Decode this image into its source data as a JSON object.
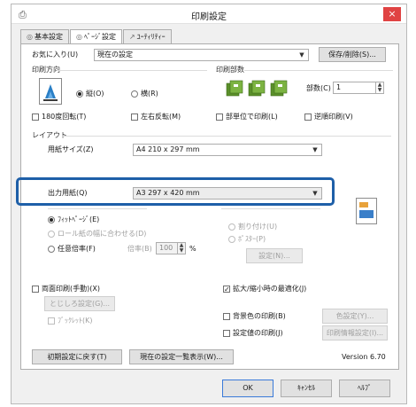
{
  "window": {
    "title": "印刷設定",
    "app_icon": "printer-icon",
    "close_label": "×"
  },
  "tabs": [
    {
      "icon": "◎",
      "label": "基本設定"
    },
    {
      "icon": "◎",
      "label": "ﾍﾟｰｼﾞ設定"
    },
    {
      "icon": "↗",
      "label": "ﾕｰﾃｨﾘﾃｨｰ"
    }
  ],
  "favorites": {
    "label": "お気に入り(U)",
    "value": "現在の設定",
    "save_button": "保存/削除(S)..."
  },
  "orientation": {
    "title": "印刷方向",
    "portrait": "縦(O)",
    "landscape": "横(R)",
    "rotate180": "180度回転(T)",
    "mirror": "左右反転(M)"
  },
  "copies": {
    "title": "印刷部数",
    "count_label": "部数(C)",
    "count_value": "1",
    "collate": "部単位で印刷(L)",
    "reverse": "逆順印刷(V)"
  },
  "layout": {
    "title": "レイアウト",
    "paper_size_label": "用紙サイズ(Z)",
    "paper_size_value": "A4 210 x 297 mm",
    "output_paper_label": "出力用紙(Q)",
    "output_paper_value": "A3 297 x 420 mm",
    "scale_fit_page": "ﾌｨｯﾄﾍﾟｰｼﾞ(E)",
    "scale_roll": "ロール紙の幅に合わせる(D)",
    "scale_custom": "任意倍率(F)",
    "scale_percent_label": "倍率(B)",
    "scale_percent_value": "100",
    "scale_percent_unit": "%",
    "multi_page": "割り付け(U)",
    "poster": "ﾎﾟｽﾀｰ(P)",
    "settings_button": "設定(N)..."
  },
  "duplex": {
    "manual": "両面印刷(手動)(X)",
    "binding_button": "とじしろ設定(G)...",
    "booklet": "ﾌﾞｯｸﾚｯﾄ(K)"
  },
  "misc": {
    "reduce_enlarge_opt": "拡大/縮小時の最適化(J)",
    "bg_color": "背景色の印刷(B)",
    "bg_color_button": "色設定(Y)...",
    "print_info": "設定値の印刷(J)",
    "print_info_button": "印刷情報設定(I)..."
  },
  "footer": {
    "defaults_button": "初期設定に戻す(T)",
    "list_button": "現在の設定一覧表示(W)...",
    "version": "Version 6.70"
  },
  "buttons": {
    "ok": "OK",
    "cancel": "ｷｬﾝｾﾙ",
    "help": "ﾍﾙﾌﾟ"
  }
}
